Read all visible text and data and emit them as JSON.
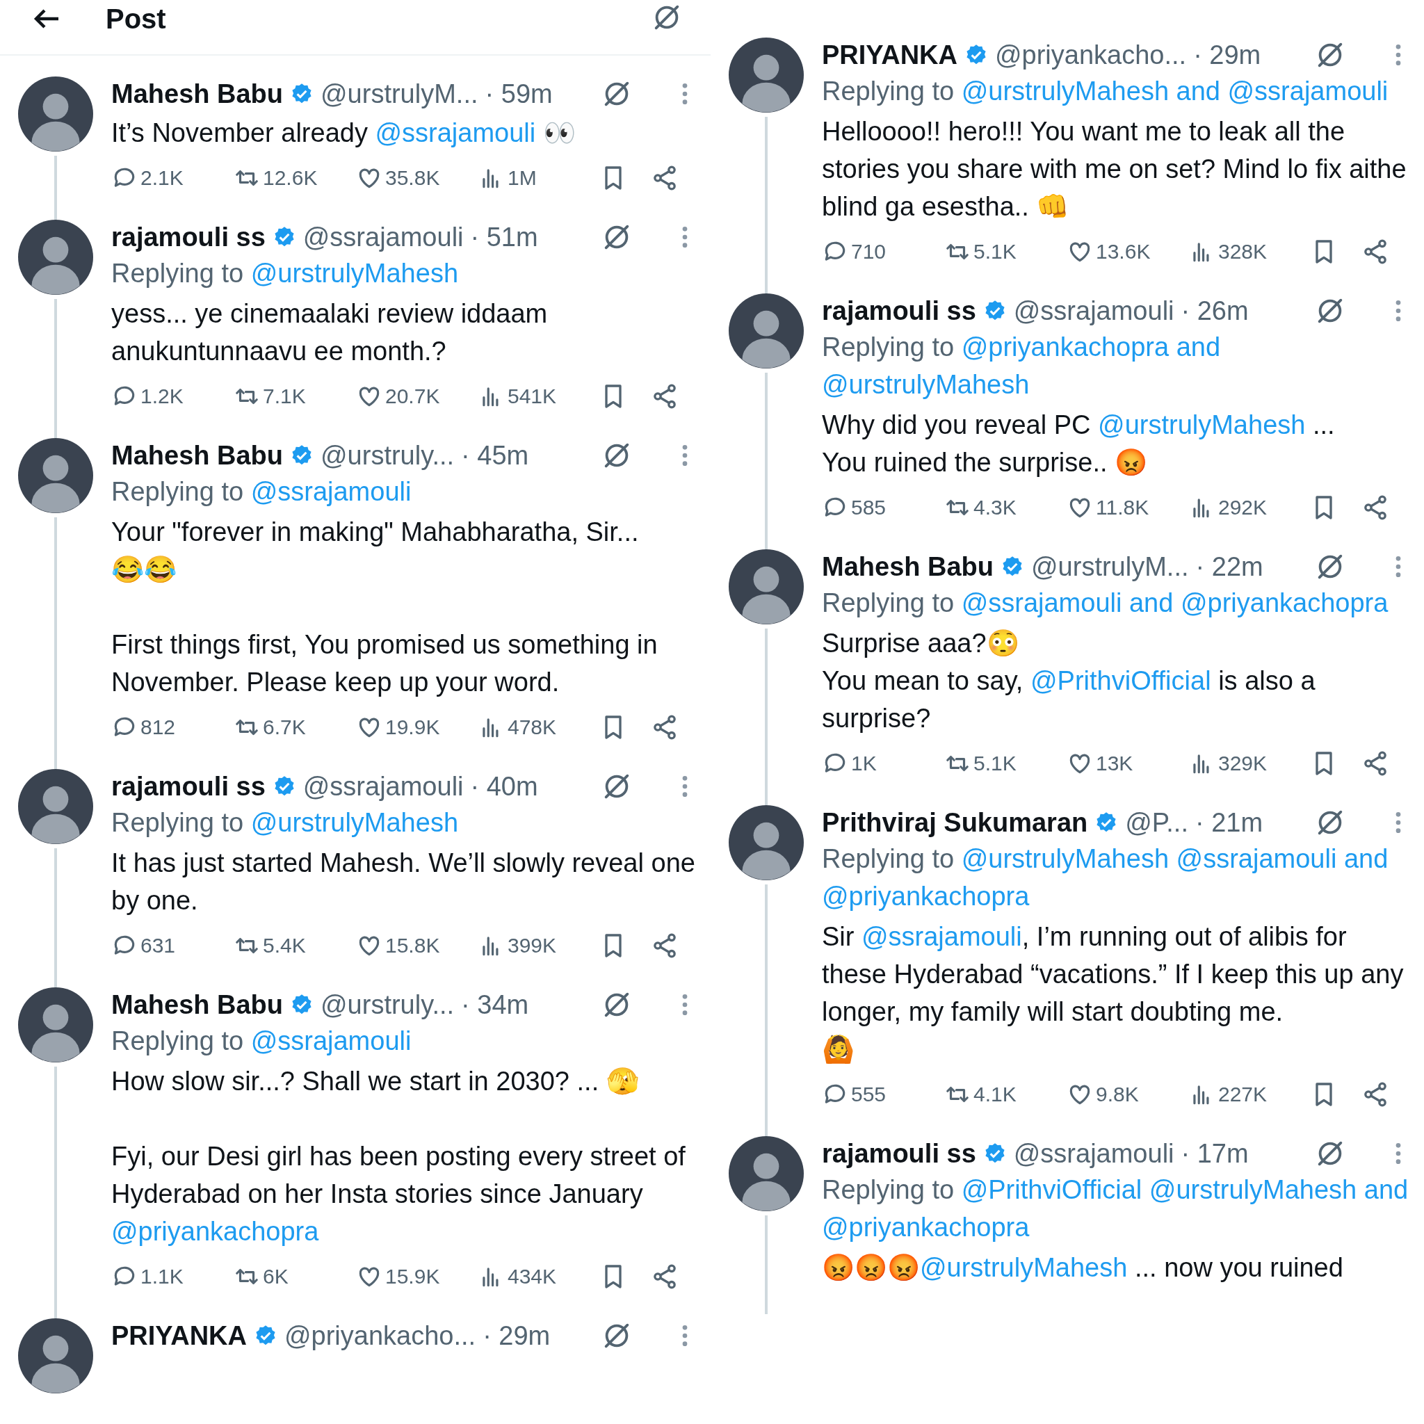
{
  "header": {
    "title": "Post"
  },
  "columns": [
    {
      "tweets": [
        {
          "name": "Mahesh Babu",
          "verified": true,
          "handle": "@urstrulyM...",
          "time": "· 59m",
          "body": [
            [
              {
                "text": "It’s November already "
              },
              {
                "text": "@ssrajamouli",
                "kind": "mention"
              },
              {
                "text": " 👀"
              }
            ]
          ],
          "stats": {
            "replies": "2.1K",
            "reposts": "12.6K",
            "likes": "35.8K",
            "views": "1M"
          }
        },
        {
          "name": "rajamouli ss",
          "verified": true,
          "handle": "@ssrajamouli",
          "time": "· 51m",
          "replying_to": {
            "label": "Replying to",
            "targets": [
              "@urstrulyMahesh"
            ]
          },
          "body": [
            [
              {
                "text": "yess... ye cinemaalaki review iddaam anukuntunnaavu ee month.?"
              }
            ]
          ],
          "stats": {
            "replies": "1.2K",
            "reposts": "7.1K",
            "likes": "20.7K",
            "views": "541K"
          }
        },
        {
          "name": "Mahesh Babu",
          "verified": true,
          "handle": "@urstruly...",
          "time": "· 45m",
          "replying_to": {
            "label": "Replying to",
            "targets": [
              "@ssrajamouli"
            ]
          },
          "body": [
            [
              {
                "text": "Your \"forever in making\" Mahabharatha, Sir...\n😂😂"
              }
            ],
            [
              {
                "text": "First things first, You promised us something in November. Please keep up your word."
              }
            ]
          ],
          "stats": {
            "replies": "812",
            "reposts": "6.7K",
            "likes": "19.9K",
            "views": "478K"
          }
        },
        {
          "name": "rajamouli ss",
          "verified": true,
          "handle": "@ssrajamouli",
          "time": "· 40m",
          "replying_to": {
            "label": "Replying to",
            "targets": [
              "@urstrulyMahesh"
            ]
          },
          "body": [
            [
              {
                "text": "It has just started Mahesh. We’ll slowly reveal one by one."
              }
            ]
          ],
          "stats": {
            "replies": "631",
            "reposts": "5.4K",
            "likes": "15.8K",
            "views": "399K"
          }
        },
        {
          "name": "Mahesh Babu",
          "verified": true,
          "handle": "@urstruly...",
          "time": "· 34m",
          "replying_to": {
            "label": "Replying to",
            "targets": [
              "@ssrajamouli"
            ]
          },
          "body": [
            [
              {
                "text": "How slow sir...? Shall we start in 2030? ... 🫣"
              }
            ],
            [
              {
                "text": "Fyi, our Desi girl has been posting every street of Hyderabad on her Insta stories since January "
              },
              {
                "text": "@priyankachopra",
                "kind": "mention"
              }
            ]
          ],
          "stats": {
            "replies": "1.1K",
            "reposts": "6K",
            "likes": "15.9K",
            "views": "434K"
          }
        },
        {
          "name": "PRIYANKA",
          "verified": true,
          "handle": "@priyankacho...",
          "time": "· 29m"
        }
      ]
    },
    {
      "tweets": [
        {
          "name": "PRIYANKA",
          "verified": true,
          "handle": "@priyankacho...",
          "time": "· 29m",
          "replying_to": {
            "label": "Replying to",
            "targets": [
              "@urstrulyMahesh",
              "@ssrajamouli"
            ],
            "joiner": "and"
          },
          "body": [
            [
              {
                "text": "Helloooo!! hero!!! You want me to leak all the stories you share with me on set? Mind lo fix aithe blind ga esestha.. 👊"
              }
            ]
          ],
          "stats": {
            "replies": "710",
            "reposts": "5.1K",
            "likes": "13.6K",
            "views": "328K"
          }
        },
        {
          "name": "rajamouli ss",
          "verified": true,
          "handle": "@ssrajamouli",
          "time": "· 26m",
          "replying_to": {
            "label": "Replying to",
            "targets": [
              "@priyankachopra",
              "@urstrulyMahesh"
            ],
            "joiner": "and"
          },
          "body": [
            [
              {
                "text": "Why did you reveal PC "
              },
              {
                "text": "@urstrulyMahesh",
                "kind": "mention"
              },
              {
                "text": " ...\nYou ruined the surprise.. 😡"
              }
            ]
          ],
          "stats": {
            "replies": "585",
            "reposts": "4.3K",
            "likes": "11.8K",
            "views": "292K"
          }
        },
        {
          "name": "Mahesh Babu",
          "verified": true,
          "handle": "@urstrulyM...",
          "time": "· 22m",
          "replying_to": {
            "label": "Replying to",
            "targets": [
              "@ssrajamouli",
              "@priyankachopra"
            ],
            "joiner": "and"
          },
          "body": [
            [
              {
                "text": "Surprise aaa?😳\nYou mean to say, "
              },
              {
                "text": "@PrithviOfficial",
                "kind": "mention"
              },
              {
                "text": " is also a surprise?"
              }
            ]
          ],
          "stats": {
            "replies": "1K",
            "reposts": "5.1K",
            "likes": "13K",
            "views": "329K"
          }
        },
        {
          "name": "Prithviraj Sukumaran",
          "verified": true,
          "handle": "@P...",
          "time": "· 21m",
          "replying_to": {
            "label": "Replying to",
            "targets": [
              "@urstrulyMahesh",
              "@ssrajamouli",
              "@priyankachopra"
            ],
            "joiner": "and"
          },
          "body": [
            [
              {
                "text": "Sir "
              },
              {
                "text": "@ssrajamouli",
                "kind": "mention"
              },
              {
                "text": ", I’m running out of alibis for these Hyderabad “vacations.” If I keep this up any longer, my family will start doubting me.\n🙆"
              }
            ]
          ],
          "stats": {
            "replies": "555",
            "reposts": "4.1K",
            "likes": "9.8K",
            "views": "227K"
          }
        },
        {
          "name": "rajamouli ss",
          "verified": true,
          "handle": "@ssrajamouli",
          "time": "· 17m",
          "replying_to": {
            "label": "Replying to",
            "targets": [
              "@PrithviOfficial",
              "@urstrulyMahesh",
              "@priyankachopra"
            ],
            "joiner": "and"
          },
          "body": [
            [
              {
                "text": "😡😡😡"
              },
              {
                "text": "@urstrulyMahesh",
                "kind": "mention"
              },
              {
                "text": " ... now you ruined"
              }
            ]
          ]
        }
      ]
    }
  ]
}
